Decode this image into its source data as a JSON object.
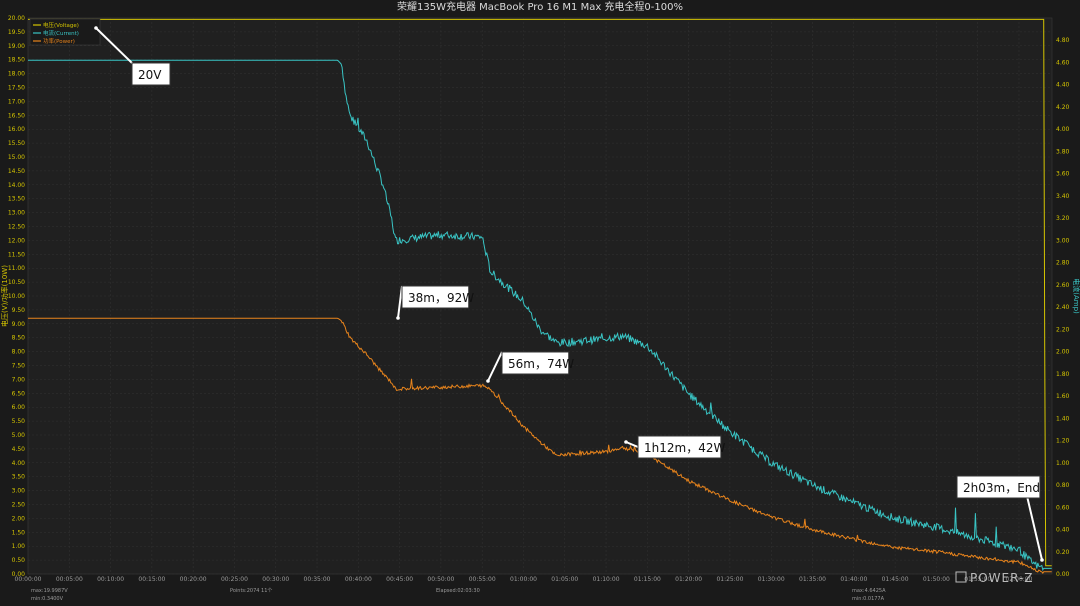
{
  "chart_data": {
    "type": "line",
    "title": "荣耀135W充电器 MacBook Pro 16 M1 Max 充电全程0-100%",
    "ylabel_left": "电压(V)/功率(10W)",
    "ylabel_right": "电流(Amp)",
    "x_ticks": [
      "00:00:00",
      "00:05:00",
      "00:10:00",
      "00:15:00",
      "00:20:00",
      "00:25:00",
      "00:30:00",
      "00:35:00",
      "00:40:00",
      "00:45:00",
      "00:50:00",
      "00:55:00",
      "01:00:00",
      "01:05:00",
      "01:10:00",
      "01:15:00",
      "01:20:00",
      "01:25:00",
      "01:30:00",
      "01:35:00",
      "01:40:00",
      "01:45:00",
      "01:50:00",
      "01:55:00",
      "02:00:00"
    ],
    "x_range_min": [
      0,
      124
    ],
    "y_left_range": [
      0,
      20
    ],
    "y_left_ticks": [
      "0.00",
      "0.50",
      "1.00",
      "1.50",
      "2.00",
      "2.50",
      "3.00",
      "3.50",
      "4.00",
      "4.50",
      "5.00",
      "5.50",
      "6.00",
      "6.50",
      "7.00",
      "7.50",
      "8.00",
      "8.50",
      "9.00",
      "9.50",
      "10.00",
      "10.50",
      "11.00",
      "11.50",
      "12.00",
      "12.50",
      "13.00",
      "13.50",
      "14.00",
      "14.50",
      "15.00",
      "15.50",
      "16.00",
      "16.50",
      "17.00",
      "17.50",
      "18.00",
      "18.50",
      "19.00",
      "19.50",
      "20.00"
    ],
    "y_right_range": [
      0,
      5
    ],
    "y_right_ticks": [
      "0.00",
      "0.20",
      "0.40",
      "0.60",
      "0.80",
      "1.00",
      "1.20",
      "1.40",
      "1.60",
      "1.80",
      "2.00",
      "2.20",
      "2.40",
      "2.60",
      "2.80",
      "3.00",
      "3.20",
      "3.40",
      "3.60",
      "3.80",
      "4.00",
      "4.20",
      "4.40",
      "4.60",
      "4.80"
    ],
    "legend": {
      "placement": "top-left",
      "entries": [
        "电压(Voltage)",
        "电流(Current)",
        "功率(Power)"
      ]
    },
    "series": [
      {
        "name": "电压(Voltage)",
        "axis": "left",
        "color": "#d4c400",
        "x": [
          0,
          10,
          20,
          30,
          40,
          50,
          60,
          70,
          80,
          90,
          100,
          110,
          120,
          123,
          123.2,
          124
        ],
        "y": [
          19.95,
          19.95,
          19.95,
          19.95,
          19.95,
          19.95,
          19.95,
          19.95,
          19.95,
          19.95,
          19.95,
          19.95,
          19.95,
          19.95,
          0.3,
          0.3
        ]
      },
      {
        "name": "电流(Current)",
        "axis": "right",
        "color": "#39c4c4",
        "x": [
          0,
          37.5,
          38,
          38.5,
          39,
          41,
          43,
          44,
          44.5,
          50,
          55,
          56,
          60,
          62,
          64,
          65,
          70,
          72,
          75,
          80,
          85,
          90,
          95,
          100,
          105,
          110,
          115,
          120,
          121,
          122,
          123,
          124
        ],
        "y": [
          4.62,
          4.62,
          4.58,
          4.3,
          4.12,
          3.9,
          3.5,
          3.2,
          3.0,
          3.05,
          3.03,
          2.72,
          2.45,
          2.2,
          2.08,
          2.08,
          2.12,
          2.14,
          2.05,
          1.62,
          1.28,
          1.0,
          0.8,
          0.64,
          0.5,
          0.42,
          0.32,
          0.22,
          0.14,
          0.08,
          0.05,
          0.05
        ]
      },
      {
        "name": "功率(Power)",
        "axis": "left",
        "color": "#e8841c",
        "x": [
          0,
          37.5,
          38,
          39,
          41,
          43,
          44,
          44.5,
          50,
          55,
          56,
          60,
          62,
          64,
          65,
          70,
          72,
          75,
          80,
          85,
          90,
          95,
          100,
          105,
          110,
          115,
          120,
          121,
          122,
          123,
          124
        ],
        "y": [
          9.2,
          9.2,
          9.1,
          8.5,
          7.9,
          7.2,
          6.9,
          6.65,
          6.72,
          6.78,
          6.65,
          5.3,
          4.75,
          4.25,
          4.3,
          4.4,
          4.55,
          4.3,
          3.35,
          2.65,
          2.05,
          1.6,
          1.25,
          0.95,
          0.8,
          0.6,
          0.42,
          0.3,
          0.15,
          0.08,
          0.08
        ]
      }
    ],
    "annotations": [
      {
        "text": "20V",
        "target": [
          8,
          19.8
        ],
        "axis": "left"
      },
      {
        "text": "38m，92W",
        "target": [
          38,
          9.2
        ],
        "axis": "left"
      },
      {
        "text": "56m，74W",
        "target": [
          56,
          6.8
        ],
        "axis": "left"
      },
      {
        "text": "1h12m，42W",
        "target": [
          72,
          4.4
        ],
        "axis": "left"
      },
      {
        "text": "2h03m，End",
        "target": [
          123,
          0.3
        ],
        "axis": "left"
      }
    ],
    "footer": {
      "max_voltage": "max:19.9987V",
      "min_voltage": "min:0.3400V",
      "points": "Points:2074 11个",
      "elapsed": "Elapsed:02:03:30",
      "max_current": "max:4.6425A",
      "min_current": "min:0.0177A"
    },
    "watermark": "POWER-Z",
    "grid": true
  }
}
